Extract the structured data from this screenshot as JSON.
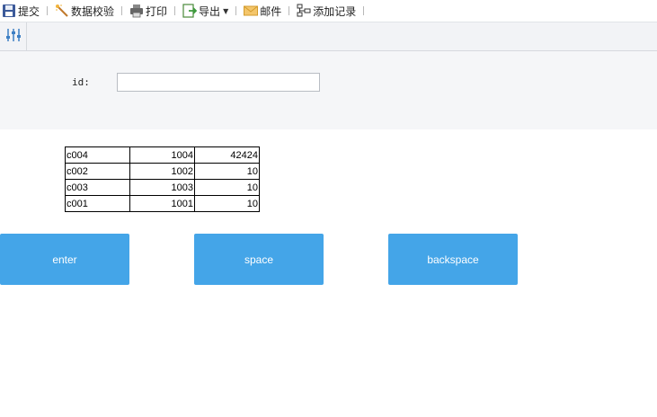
{
  "toolbar": {
    "items": [
      {
        "label": "提交",
        "icon": "save-icon"
      },
      {
        "label": "数据校验",
        "icon": "magic-wand-icon"
      },
      {
        "label": "打印",
        "icon": "printer-icon"
      },
      {
        "label": "导出",
        "icon": "export-icon"
      },
      {
        "label": "邮件",
        "icon": "mail-icon"
      },
      {
        "label": "添加记录",
        "icon": "add-record-icon"
      }
    ]
  },
  "param_bar": {
    "toggle_icon": "sliders-icon"
  },
  "form": {
    "id_label": "id:",
    "id_value": ""
  },
  "table": {
    "rows": [
      [
        "c004",
        "1004",
        "42424"
      ],
      [
        "c002",
        "1002",
        "10"
      ],
      [
        "c003",
        "1003",
        "10"
      ],
      [
        "c001",
        "1001",
        "10"
      ]
    ]
  },
  "buttons": {
    "enter": "enter",
    "space": "space",
    "backspace": "backspace"
  },
  "colors": {
    "button_bg": "#44a5e8",
    "param_bg": "#f5f6f8"
  }
}
